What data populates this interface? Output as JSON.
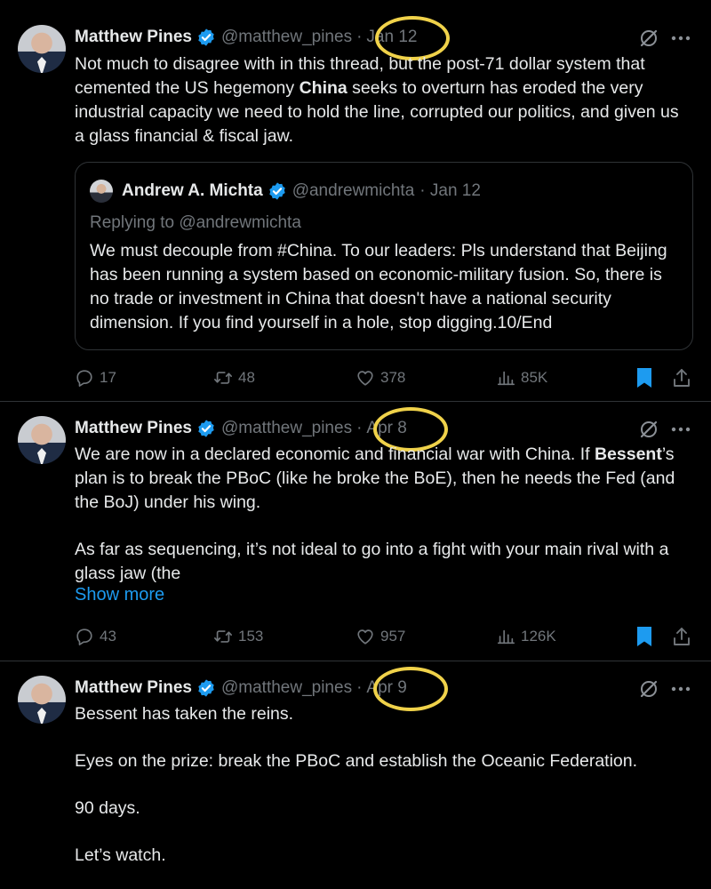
{
  "tweets": [
    {
      "author": {
        "name": "Matthew Pines",
        "handle": "@matthew_pines"
      },
      "separator": "·",
      "date": "Jan 12",
      "text_parts": [
        "Not much to disagree with in this thread, but the post-71 dollar system that cemented the US hegemony ",
        "China",
        " seeks to overturn has eroded the very industrial capacity we need to hold the line, corrupted our politics, and given us a glass financial & fiscal jaw."
      ],
      "quote": {
        "author": {
          "name": "Andrew A. Michta",
          "handle": "@andrewmichta"
        },
        "date": "· Jan 12",
        "replying_to": "Replying to @andrewmichta",
        "text": "We must decouple from #China. To our leaders: Pls understand that Beijing has been running a system based on economic-military fusion. So, there is no trade or investment in China that doesn't have a national security dimension. If you find yourself in a hole, stop digging.10/End"
      },
      "stats": {
        "replies": "17",
        "reposts": "48",
        "likes": "378",
        "views": "85K"
      }
    },
    {
      "author": {
        "name": "Matthew Pines",
        "handle": "@matthew_pines"
      },
      "separator": "·",
      "date": "Apr 8",
      "text_line1": "We are now in a declared economic and financial war with China. If",
      "text_bold": "Bessent",
      "text_line2_rest": "’s plan is to break the PBoC (like he broke the BoE), then he needs the Fed (and the BoJ) under his wing.",
      "text_para2": "As far as sequencing, it’s not ideal to go into a fight with your main rival with a glass jaw (the",
      "show_more": "Show more",
      "stats": {
        "replies": "43",
        "reposts": "153",
        "likes": "957",
        "views": "126K"
      }
    },
    {
      "author": {
        "name": "Matthew Pines",
        "handle": "@matthew_pines"
      },
      "separator": "·",
      "date": "Apr 9",
      "paragraphs": [
        "Bessent has taken the reins.",
        "Eyes on the prize: break the PBoC and establish the Oceanic Federation.",
        "90 days.",
        "Let’s watch."
      ]
    }
  ],
  "colors": {
    "background": "#000000",
    "text": "#e7e9ea",
    "muted": "#71767b",
    "link": "#1d9bf0",
    "verified": "#1d9bf0",
    "bookmark": "#1d9bf0",
    "highlight_ring": "#f0d24a"
  },
  "icons": [
    "verified-badge-icon",
    "grok-icon",
    "more-icon",
    "reply-icon",
    "repost-icon",
    "like-icon",
    "views-icon",
    "bookmark-icon",
    "share-icon"
  ]
}
